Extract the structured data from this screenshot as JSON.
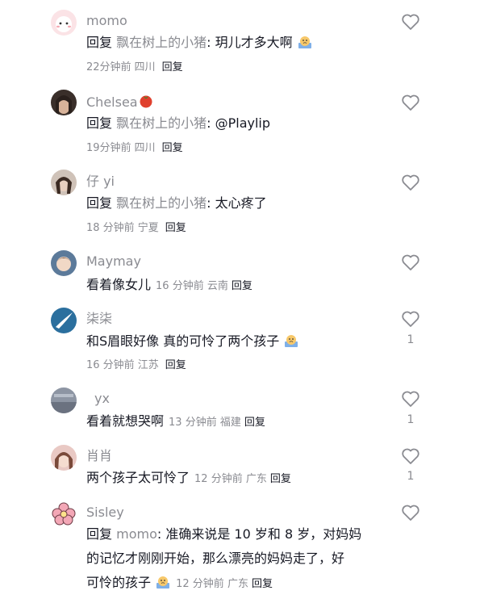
{
  "common": {
    "reply_label": "回复"
  },
  "comments": [
    {
      "username": "momo",
      "reply_prefix": "回复",
      "reply_target": "飘在树上的小猪",
      "text": "玥儿才多大啊",
      "emoji": "crying-emoji-icon",
      "time": "22分钟前",
      "location": "四川",
      "likes": ""
    },
    {
      "username": "Chelsea",
      "name_emoji": "tomato-icon",
      "reply_prefix": "回复",
      "reply_target": "飘在树上的小猪",
      "text": "@Playlip",
      "time": "19分钟前",
      "location": "四川",
      "likes": ""
    },
    {
      "username": "仔 yi",
      "reply_prefix": "回复",
      "reply_target": "飘在树上的小猪",
      "text": "太心疼了",
      "time": "18 分钟前",
      "location": "宁夏",
      "likes": ""
    },
    {
      "username": "Maymay",
      "text": "看着像女儿",
      "time": "16 分钟前",
      "location": "云南",
      "likes": ""
    },
    {
      "username": "柒柒",
      "text": "和S眉眼好像 真的可怜了两个孩子",
      "emoji": "crying-emoji-icon",
      "time": "16 分钟前",
      "location": "江苏",
      "likes": "1"
    },
    {
      "username": "yx",
      "text": "看着就想哭啊",
      "time": "13 分钟前",
      "location": "福建",
      "likes": "1"
    },
    {
      "username": "肖肖",
      "text": "两个孩子太可怜了",
      "time": "12 分钟前",
      "location": "广东",
      "likes": "1"
    },
    {
      "username": "Sisley",
      "reply_prefix": "回复",
      "reply_target": "momo",
      "text_line1": "准确来说是 10 岁和 8 岁，对妈妈",
      "text_line2": "的记忆才刚刚开始，那么漂亮的妈妈走了，好",
      "text_line3": "可怜的孩子",
      "emoji": "crying-emoji-icon",
      "time": "12 分钟前",
      "location": "广东",
      "likes": ""
    }
  ]
}
